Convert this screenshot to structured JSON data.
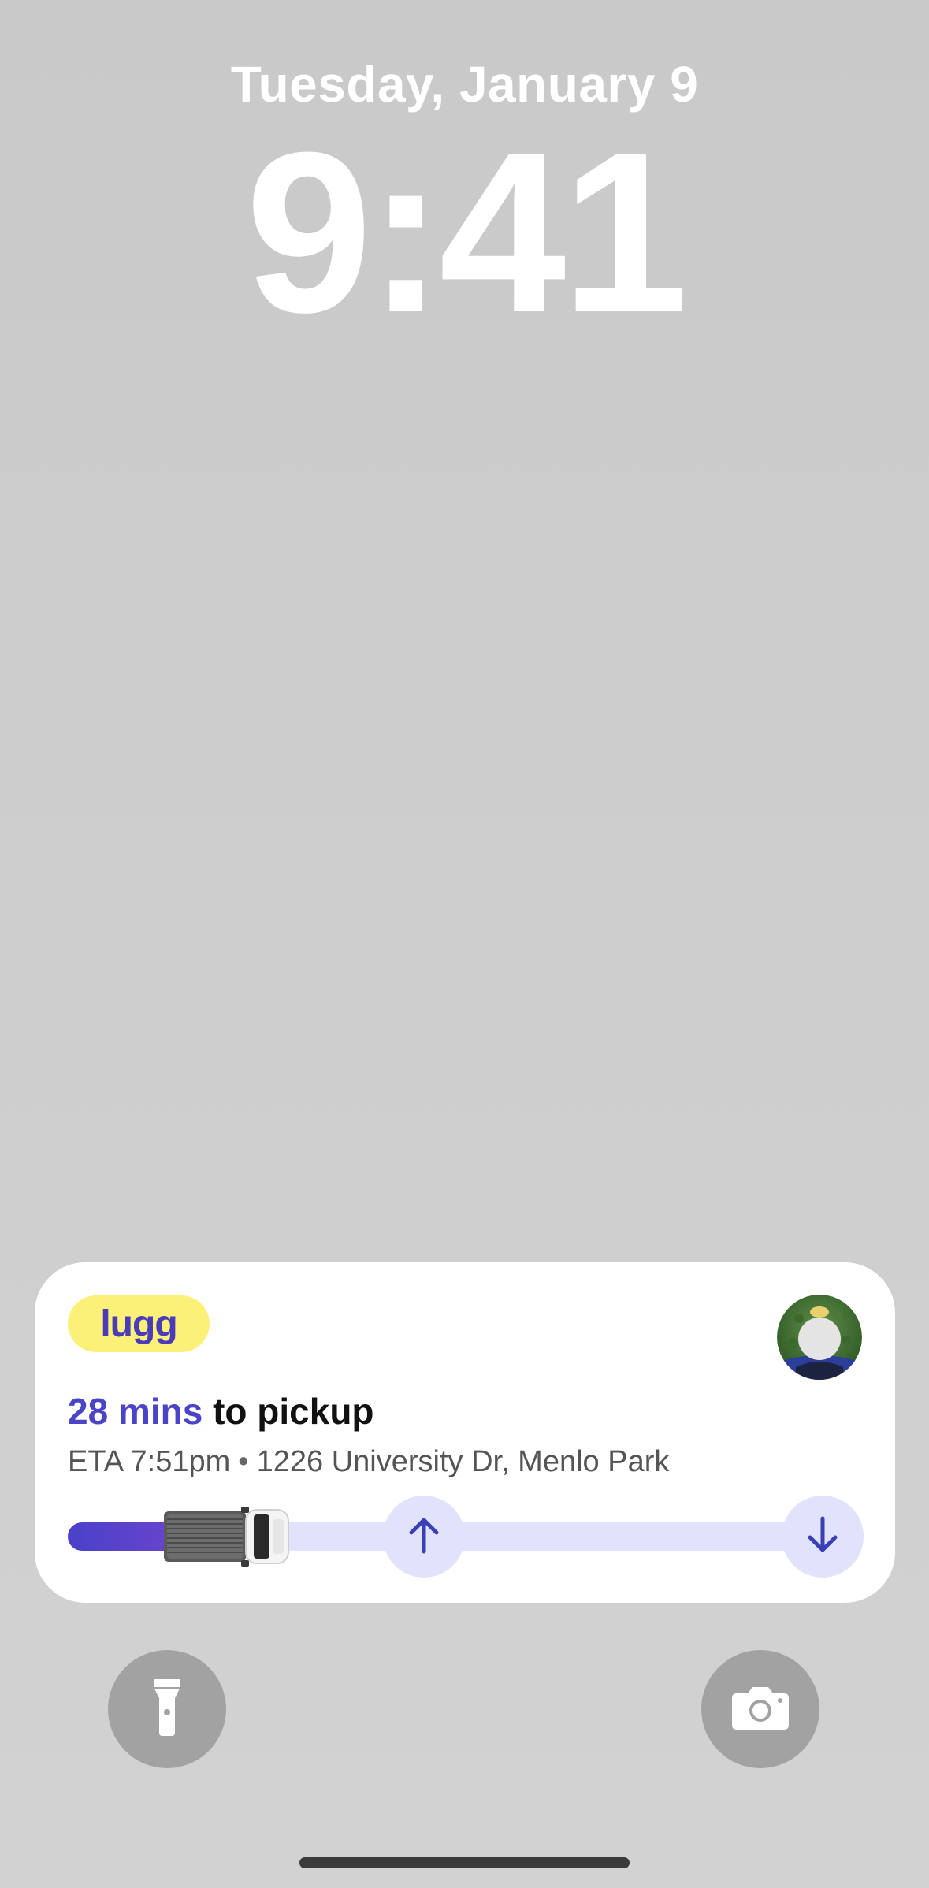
{
  "lockscreen": {
    "date": "Tuesday, January 9",
    "time": "9:41"
  },
  "activity": {
    "brand": "lugg",
    "headline_accent": "28 mins",
    "headline_rest": " to pickup",
    "eta": "ETA 7:51pm",
    "separator": "•",
    "address": "1226 University Dr, Menlo Park",
    "progress_fraction": 0.14,
    "icons": {
      "avatar": "driver-avatar",
      "truck": "truck-icon",
      "pickup": "arrow-up-icon",
      "dropoff": "arrow-down-icon"
    }
  },
  "quick_actions": {
    "flashlight": "flashlight-icon",
    "camera": "camera-icon"
  },
  "colors": {
    "accent": "#4b44c6",
    "brand_bg": "#fbf178",
    "track": "#e0e3fb",
    "quick_bg": "#a2a2a2"
  }
}
